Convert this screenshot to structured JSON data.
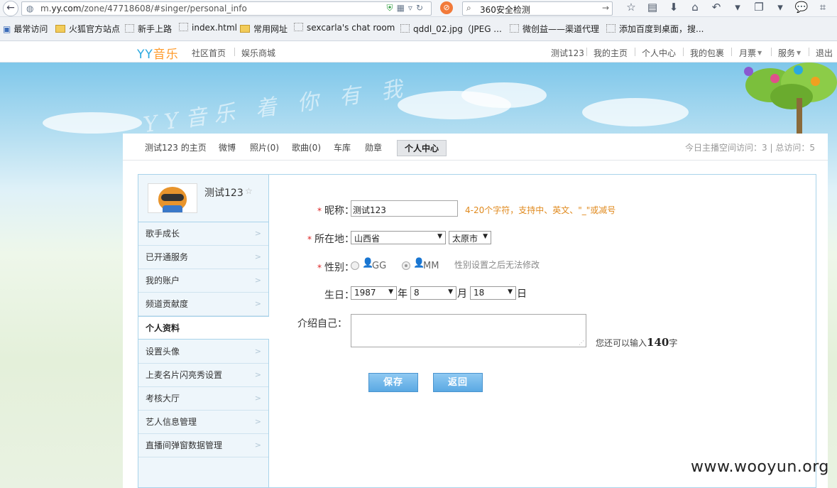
{
  "browser": {
    "url_prefix": "m.",
    "url_domain": "yy.com",
    "url_rest": "/zone/47718608/#singer/personal_info",
    "search_text": "360安全检测",
    "bookmarks": [
      "最常访问",
      "火狐官方站点",
      "新手上路",
      "index.html",
      "常用网址",
      "sexcarla's chat room",
      "qddl_02.jpg（JPEG ...",
      "微创益——渠道代理",
      "添加百度到桌面，搜..."
    ]
  },
  "site": {
    "logo_yy": "YY",
    "logo_music": "音乐",
    "left_nav": [
      "社区首页",
      "娱乐商城"
    ],
    "right_nav": [
      "测试123",
      "我的主页",
      "个人中心",
      "我的包裹",
      "月票",
      "服务",
      "退出"
    ],
    "banner_text": "YY音乐 着 你 有 我"
  },
  "subnav": {
    "tabs": [
      "测试123 的主页",
      "微博",
      "照片(0)",
      "歌曲(0)",
      "车库",
      "勋章",
      "个人中心"
    ],
    "visits": "今日主播空间访问：3 | 总访问：5"
  },
  "sidebar": {
    "username": "测试123",
    "items": [
      "歌手成长",
      "已开通服务",
      "我的账户",
      "频道贡献度",
      "个人资料",
      "设置头像",
      "上麦名片闪亮秀设置",
      "考核大厅",
      "艺人信息管理",
      "直播间弹窗数据管理"
    ]
  },
  "form": {
    "required_mark": "*",
    "nickname_label": "昵称：",
    "nickname_value": "测试123",
    "nickname_hint": "4-20个字符，支持中、英文、\"_\"或减号",
    "location_label": "所在地：",
    "province": "山西省",
    "city": "太原市",
    "gender_label": "性别：",
    "gender_gg": "GG",
    "gender_mm": "MM",
    "gender_hint": "性别设置之后无法修改",
    "birthday_label": "生日：",
    "birth_year": "1987",
    "birth_month": "8",
    "birth_day": "18",
    "unit_year": "年",
    "unit_month": "月",
    "unit_day": "日",
    "intro_label": "介绍自己：",
    "counter_prefix": "您还可以输入",
    "counter_value": "140",
    "counter_suffix": "字",
    "save": "保存",
    "back": "返回"
  },
  "watermark": "www.wooyun.org"
}
